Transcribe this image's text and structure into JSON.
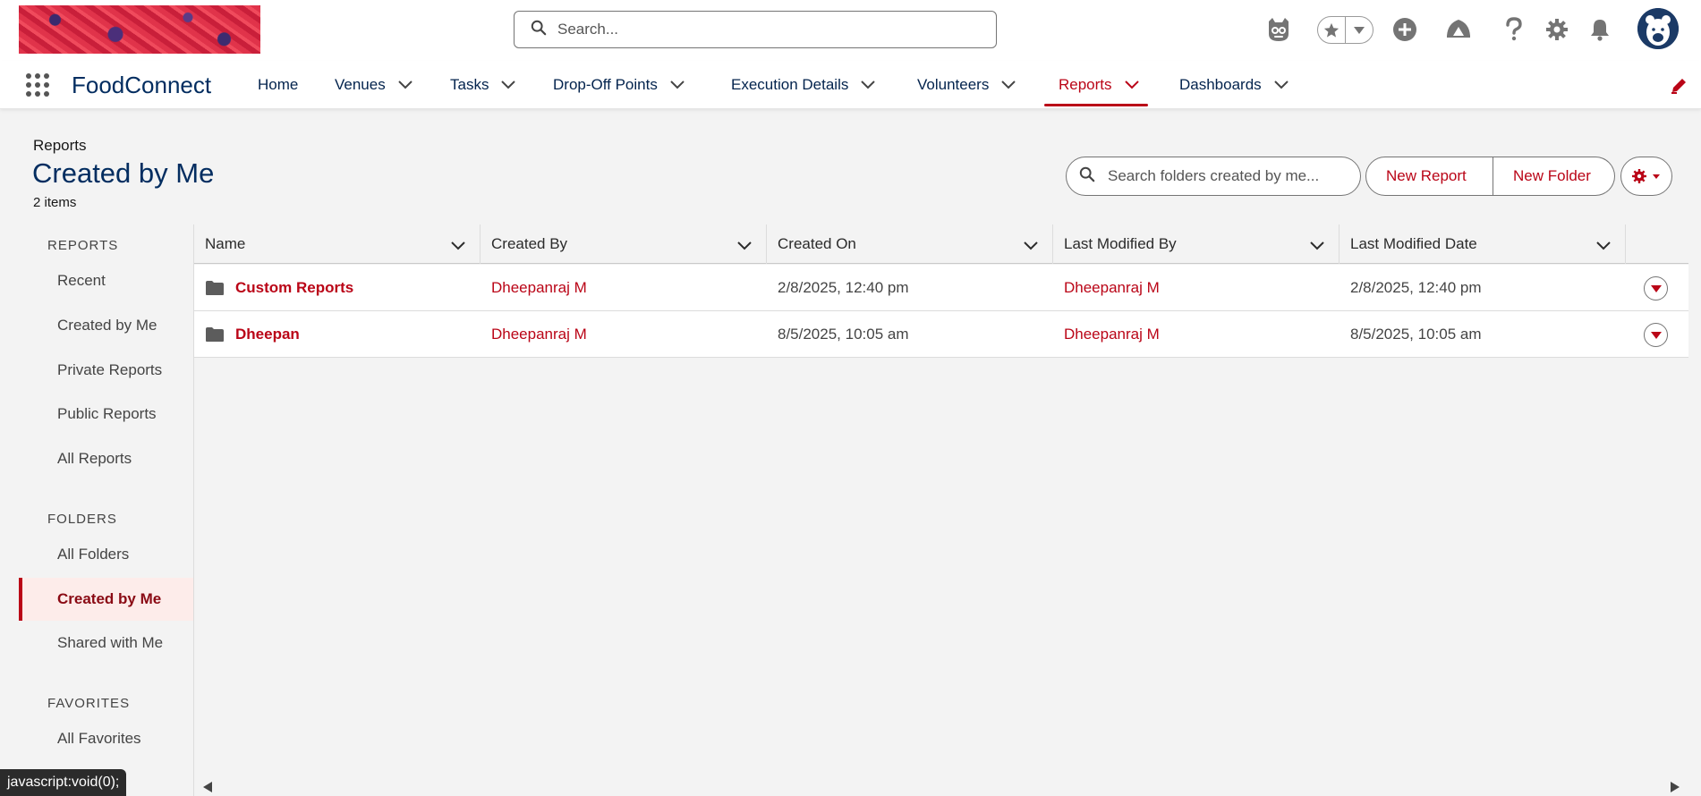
{
  "header": {
    "search_placeholder": "Search...",
    "icons": [
      "einstein-icon",
      "favorites-star-icon",
      "add-icon",
      "trailhead-icon",
      "help-icon",
      "setup-gear-icon",
      "notification-bell-icon",
      "user-avatar"
    ]
  },
  "nav": {
    "app_name": "FoodConnect",
    "items": [
      {
        "label": "Home",
        "dropdown": false
      },
      {
        "label": "Venues",
        "dropdown": true
      },
      {
        "label": "Tasks",
        "dropdown": true
      },
      {
        "label": "Drop-Off Points",
        "dropdown": true
      },
      {
        "label": "Execution Details",
        "dropdown": true
      },
      {
        "label": "Volunteers",
        "dropdown": true
      },
      {
        "label": "Reports",
        "dropdown": true,
        "active": true
      },
      {
        "label": "Dashboards",
        "dropdown": true
      }
    ]
  },
  "page": {
    "breadcrumb": "Reports",
    "title": "Created by Me",
    "count": "2 items",
    "folder_search_placeholder": "Search folders created by me...",
    "new_report_label": "New Report",
    "new_folder_label": "New Folder"
  },
  "sidebar": {
    "sections": [
      {
        "title": "REPORTS",
        "items": [
          "Recent",
          "Created by Me",
          "Private Reports",
          "Public Reports",
          "All Reports"
        ]
      },
      {
        "title": "FOLDERS",
        "items": [
          "All Folders",
          "Created by Me",
          "Shared with Me"
        ]
      },
      {
        "title": "FAVORITES",
        "items": [
          "All Favorites"
        ]
      }
    ],
    "selected": "FOLDERS / Created by Me"
  },
  "table": {
    "columns": [
      "Name",
      "Created By",
      "Created On",
      "Last Modified By",
      "Last Modified Date"
    ],
    "rows": [
      {
        "name": "Custom Reports",
        "created_by": "Dheepanraj M",
        "created_on": "2/8/2025, 12:40 pm",
        "modified_by": "Dheepanraj M",
        "modified_date": "2/8/2025, 12:40 pm"
      },
      {
        "name": "Dheepan",
        "created_by": "Dheepanraj M",
        "created_on": "8/5/2025, 10:05 am",
        "modified_by": "Dheepanraj M",
        "modified_date": "8/5/2025, 10:05 am"
      }
    ]
  },
  "status_bar": "javascript:void(0);",
  "colors": {
    "brand_red": "#ba0517",
    "title_navy": "#032d60",
    "background": "#f3f3f3"
  }
}
